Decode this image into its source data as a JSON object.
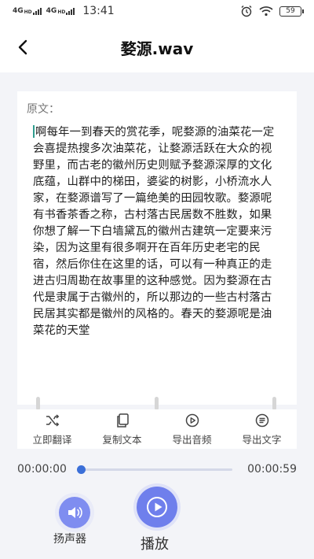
{
  "status_bar": {
    "network_1": "4G",
    "network_1_sup": "HD",
    "network_2": "4G",
    "network_2_sup": "HD",
    "time": "13:41",
    "battery": "59"
  },
  "header": {
    "title": "婺源.wav"
  },
  "transcript": {
    "label": "原文：",
    "text": "啊每年一到春天的赏花季，呢婺源的油菜花一定会喜提热搜多次油菜花，让婺源活跃在大众的视野里，而古老的徽州历史则赋予婺源深厚的文化底蕴，山群中的梯田，婆娑的树影，小桥流水人家，在婺源谱写了一篇绝美的田园牧歌。婺源呢有书香茶香之称，古村落古民居数不胜数，如果你想了解一下白墙黛瓦的徽州古建筑一定要来污染，因为这里有很多啊开在百年历史老宅的民宿，然后你住在这里的话，可以有一种真正的走进古归周勘在故事里的这种感觉。因为婺源在古代是隶属于古徽州的，所以那边的一些古村落古民居其实都是徽州的风格的。春天的婺源呢是油菜花的天堂"
  },
  "toolbar": {
    "translate": "立即翻译",
    "copy": "复制文本",
    "export_audio": "导出音频",
    "export_text": "导出文字"
  },
  "player": {
    "current_time": "00:00:00",
    "total_time": "00:00:59",
    "progress": 0,
    "speaker_label": "扬声器",
    "play_label": "播放"
  },
  "colors": {
    "accent": "#6f7fec",
    "progress": "#3b6fd8",
    "background": "#f3f4f8"
  },
  "icons": {
    "back": "chevron-left-icon",
    "translate": "shuffle-icon",
    "copy": "copy-icon",
    "export_audio": "play-circle-icon",
    "export_text": "text-lines-icon",
    "speaker": "speaker-icon",
    "play": "play-icon"
  }
}
